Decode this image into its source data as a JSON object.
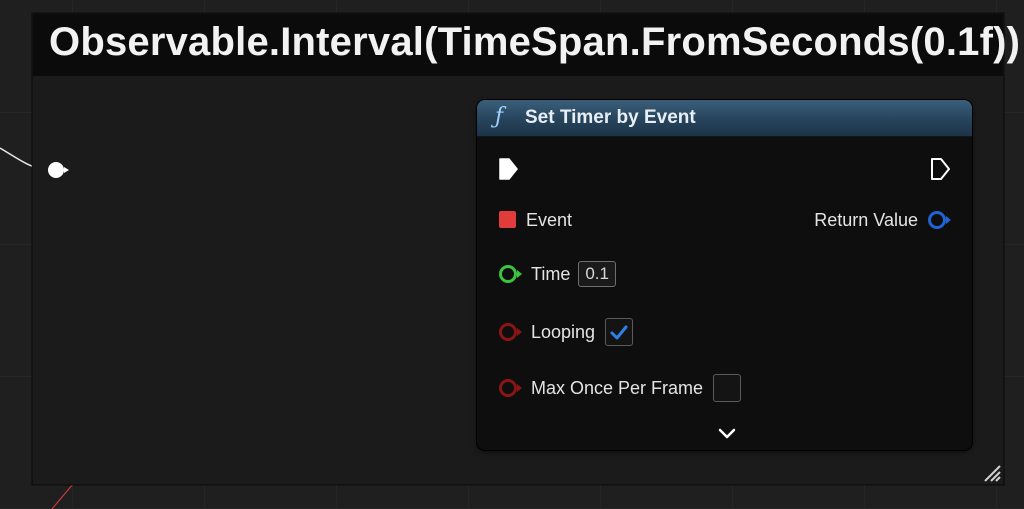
{
  "comment": {
    "title": "Observable.Interval(TimeSpan.FromSeconds(0.1f))"
  },
  "node": {
    "icon": "function-icon",
    "title": "Set Timer by Event",
    "header_color": "#26445c",
    "pins": {
      "exec_in": {
        "type": "exec"
      },
      "exec_out": {
        "type": "exec"
      },
      "event": {
        "label": "Event",
        "color": "#e23b3b"
      },
      "return_value": {
        "label": "Return Value",
        "color": "#1f63d6"
      },
      "time": {
        "label": "Time",
        "value": "0.1",
        "color": "#3cc43c"
      },
      "looping": {
        "label": "Looping",
        "checked": true,
        "color": "#8a1515"
      },
      "max_once_per_frame": {
        "label": "Max Once Per Frame",
        "checked": false,
        "color": "#8a1515"
      }
    },
    "advanced_toggle_icon": "chevron-down-icon"
  },
  "wires": {
    "exec_color": "#e8e8e8",
    "delegate_color": "#c23a3a"
  }
}
